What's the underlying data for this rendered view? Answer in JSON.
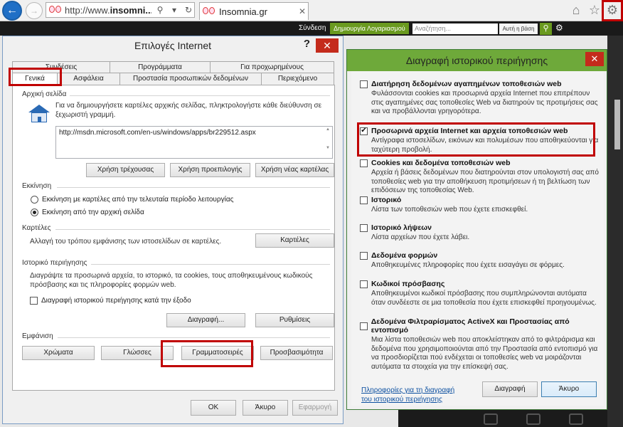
{
  "browser": {
    "address_url_plain": "http://www.",
    "address_url_bold": "insomni...",
    "tab_title": "Insomnia.gr"
  },
  "site": {
    "login": "Σύνδεση",
    "register": "Δημιουργία Λογαριασμού",
    "search_placeholder": "Αναζήτηση...",
    "exact_label": "Αυτή η βάση"
  },
  "internet_options": {
    "title": "Επιλογές Internet",
    "help": "?",
    "tabs_row1": [
      "Συνδέσεις",
      "Προγράμματα",
      "Για προχωρημένους"
    ],
    "tabs_row2": [
      "Γενικά",
      "Ασφάλεια",
      "Προστασία προσωπικών δεδομένων",
      "Περιεχόμενο"
    ],
    "home": {
      "title": "Αρχική σελίδα",
      "desc": "Για να δημιουργήσετε καρτέλες αρχικής σελίδας, πληκτρολογήστε κάθε διεύθυνση σε ξεχωριστή γραμμή.",
      "url": "http://msdn.microsoft.com/en-us/windows/apps/br229512.aspx",
      "btn_current": "Χρήση τρέχουσας",
      "btn_default": "Χρήση προεπιλογής",
      "btn_newtab": "Χρήση νέας καρτέλας"
    },
    "startup": {
      "title": "Εκκίνηση",
      "opt_last": "Εκκίνηση με καρτέλες από την τελευταία περίοδο λειτουργίας",
      "opt_home": "Εκκίνηση από την αρχική σελίδα"
    },
    "tabs": {
      "title": "Καρτέλες",
      "desc": "Αλλαγή του τρόπου εμφάνισης των ιστοσελίδων σε καρτέλες.",
      "btn": "Καρτέλες"
    },
    "history": {
      "title": "Ιστορικό περιήγησης",
      "desc": "Διαγράψτε τα προσωρινά αρχεία, το ιστορικό, τα cookies, τους αποθηκευμένους κωδικούς πρόσβασης και τις πληροφορίες φορμών web.",
      "chk_exit": "Διαγραφή ιστορικού περιήγησης κατά την έξοδο",
      "btn_delete": "Διαγραφή...",
      "btn_settings": "Ρυθμίσεις"
    },
    "appearance": {
      "title": "Εμφάνιση",
      "btn_colors": "Χρώματα",
      "btn_languages": "Γλώσσες",
      "btn_fonts": "Γραμματοσειρές",
      "btn_access": "Προσβασιμότητα"
    },
    "footer": {
      "ok": "OK",
      "cancel": "Άκυρο",
      "apply": "Εφαρμογή"
    }
  },
  "delete_history": {
    "title": "Διαγραφή ιστορικού περιήγησης",
    "options": [
      {
        "label": "Διατήρηση δεδομένων αγαπημένων τοποθεσιών web",
        "checked": false,
        "desc": "Φυλάσσονται cookies και προσωρινά αρχεία Internet που επιτρέπουν στις αγαπημένες σας τοποθεσίες Web να διατηρούν τις προτιμήσεις σας και να προβάλλονται γρηγορότερα."
      },
      {
        "label": "Προσωρινά αρχεία Internet και αρχεία τοποθεσιών web",
        "checked": true,
        "desc": "Αντίγραφα ιστοσελίδων, εικόνων και πολυμέσων που αποθηκεύονται για ταχύτερη προβολή."
      },
      {
        "label": "Cookies και δεδομένα τοποθεσιών web",
        "checked": false,
        "desc": "Αρχεία ή βάσεις δεδομένων που διατηρούνται στον υπολογιστή σας από τοποθεσίες web για την αποθήκευση προτιμήσεων ή τη βελτίωση των επιδόσεων της τοποθεσίας Web."
      },
      {
        "label": "Ιστορικό",
        "checked": false,
        "desc": "Λίστα των τοποθεσιών web που έχετε επισκεφθεί."
      },
      {
        "label": "Ιστορικό λήψεων",
        "checked": false,
        "desc": "Λίστα αρχείων που έχετε λάβει."
      },
      {
        "label": "Δεδομένα φορμών",
        "checked": false,
        "desc": "Αποθηκευμένες πληροφορίες που έχετε εισαγάγει σε φόρμες."
      },
      {
        "label": "Κωδικοί πρόσβασης",
        "checked": false,
        "desc": "Αποθηκευμένοι κωδικοί πρόσβασης που συμπληρώνονται αυτόματα όταν συνδέεστε σε μια τοποθεσία που έχετε επισκεφθεί προηγουμένως."
      },
      {
        "label": "Δεδομένα Φιλτραρίσματος ActiveX και Προστασίας από εντοπισμό",
        "checked": false,
        "desc": "Μια λίστα τοποθεσιών web που αποκλείστηκαν από το φιλτράρισμα και δεδομένα που χρησιμοποιούνται από την Προστασία από εντοπισμό για να προσδιορίζεται πού ενδέχεται οι τοποθεσίες web να μοιράζονται αυτόματα τα στοιχεία για την επίσκεψή σας."
      }
    ],
    "link": "Πληροφορίες για τη διαγραφή του ιστορικού περιήγησης",
    "btn_delete": "Διαγραφή",
    "btn_cancel": "Άκυρο"
  }
}
